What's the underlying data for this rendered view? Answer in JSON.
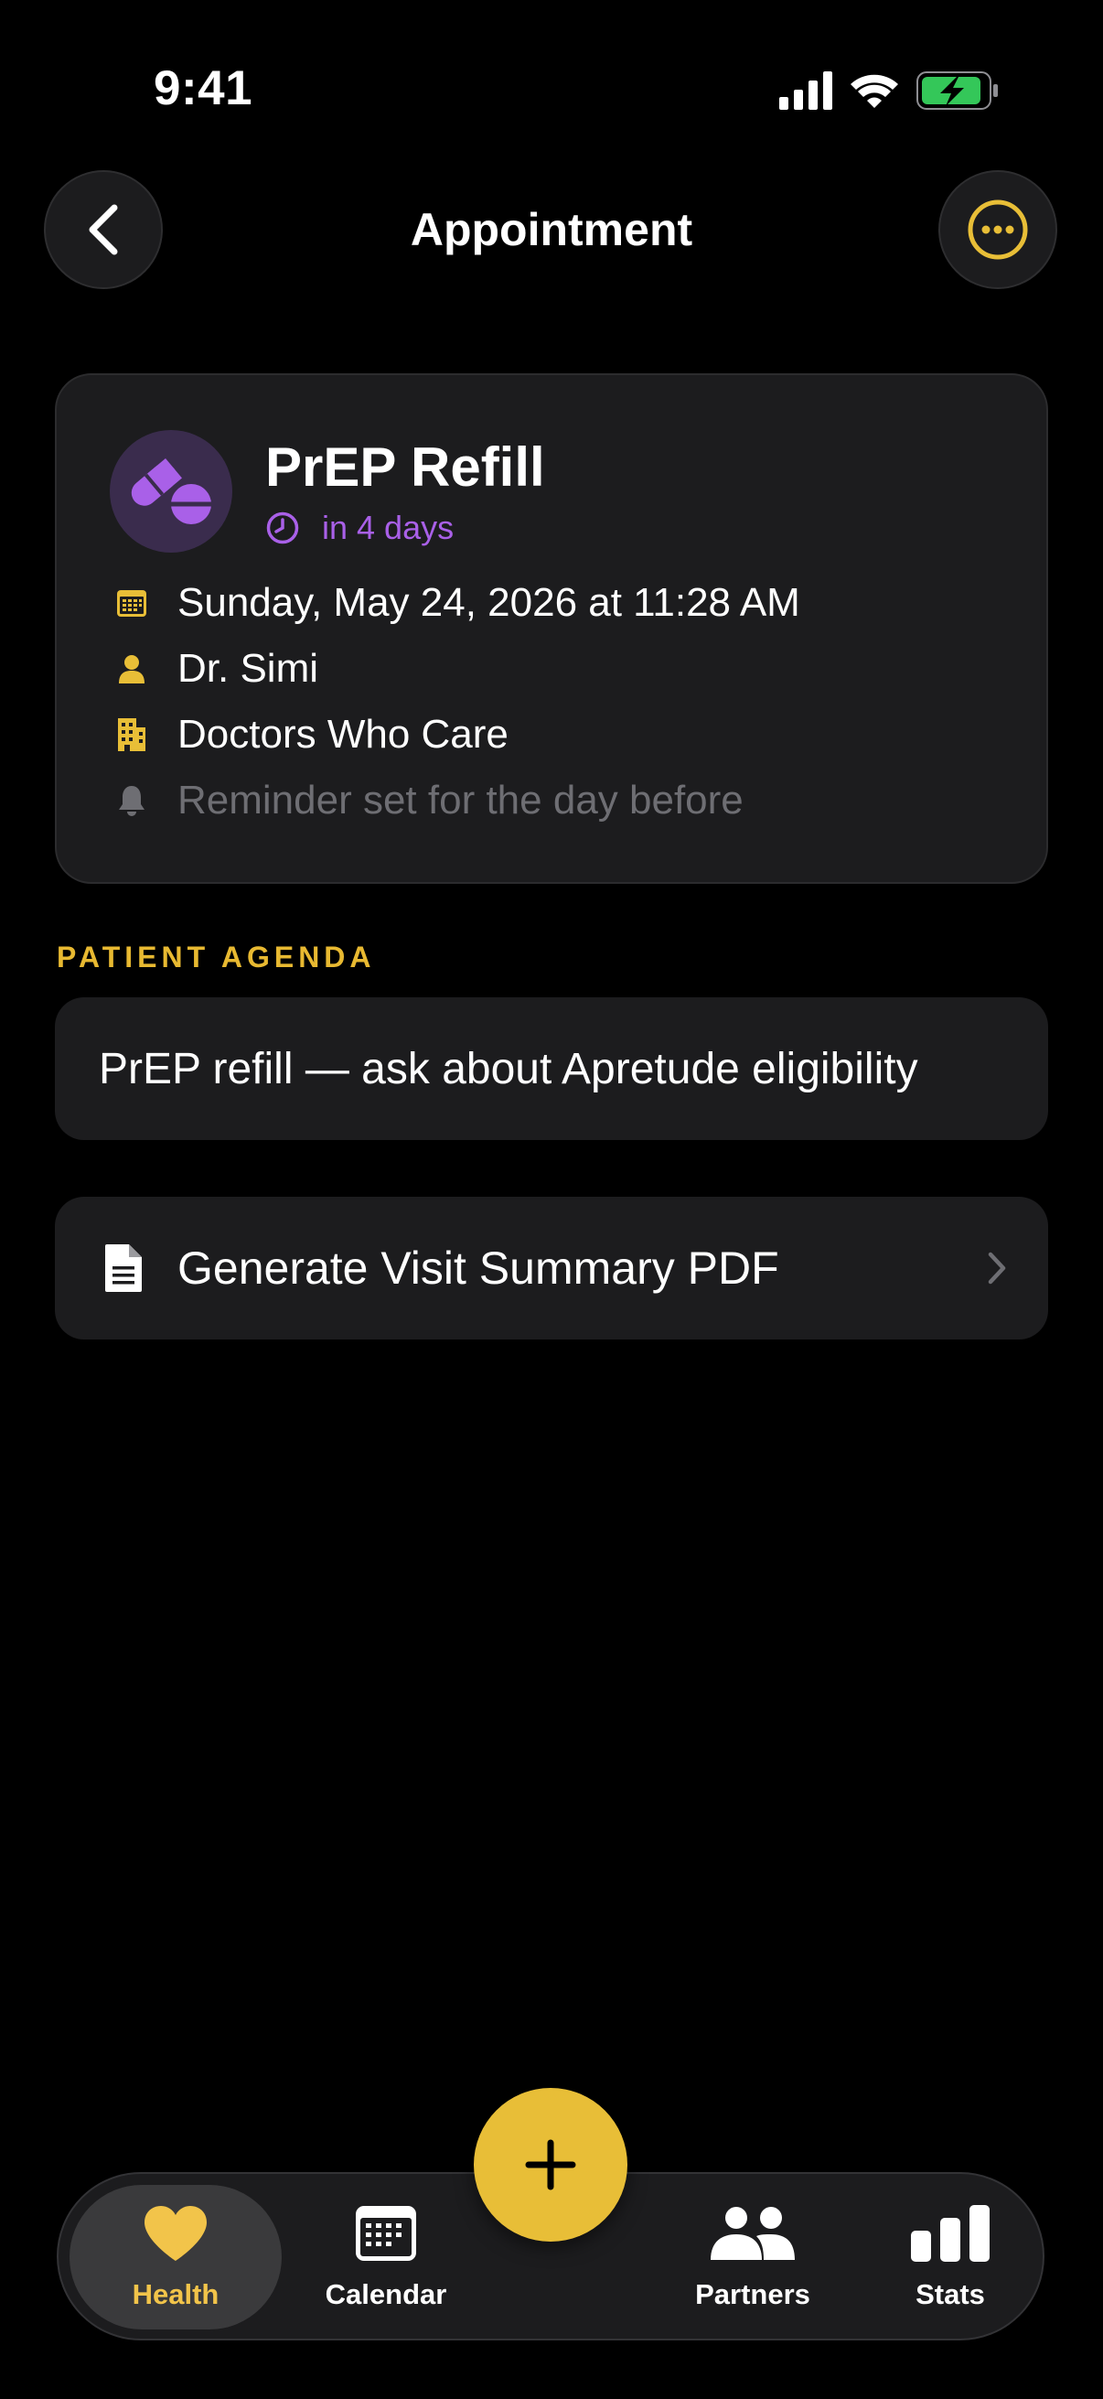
{
  "status_bar": {
    "time": "9:41"
  },
  "nav": {
    "title": "Appointment"
  },
  "appointment": {
    "title": "PrEP Refill",
    "countdown": "in 4 days",
    "datetime": "Sunday, May 24, 2026 at 11:28 AM",
    "provider": "Dr. Simi",
    "clinic": "Doctors Who Care",
    "reminder": "Reminder set for the day before"
  },
  "agenda": {
    "section_label": "PATIENT AGENDA",
    "text": "PrEP refill — ask about Apretude eligibility"
  },
  "actions": {
    "generate_pdf": "Generate Visit Summary PDF"
  },
  "tabs": [
    {
      "label": "Health",
      "icon": "heart-icon",
      "active": true
    },
    {
      "label": "Calendar",
      "icon": "calendar-icon"
    },
    {
      "label": "Partners",
      "icon": "people-icon"
    },
    {
      "label": "Stats",
      "icon": "bar-chart-icon"
    }
  ],
  "colors": {
    "accent": "#E8BE37",
    "purple": "#A960E8",
    "card": "#1C1C1E",
    "muted": "#6E6E73",
    "battery": "#34C759"
  }
}
